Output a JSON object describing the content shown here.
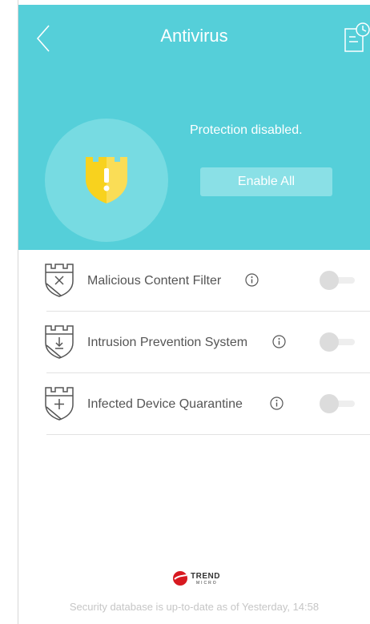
{
  "header": {
    "title": "Antivirus",
    "back_icon": "chevron-left-icon",
    "log_icon": "document-clock-icon",
    "background_color": "#55cfd9"
  },
  "status": {
    "shield_icon": "shield-warning-icon",
    "message": "Protection disabled.",
    "enable_all_label": "Enable All"
  },
  "features": [
    {
      "label": "Malicious Content Filter",
      "icon": "shield-x-icon",
      "enabled": false
    },
    {
      "label": "Intrusion Prevention System",
      "icon": "shield-download-icon",
      "enabled": false
    },
    {
      "label": "Infected Device Quarantine",
      "icon": "shield-plus-icon",
      "enabled": false
    }
  ],
  "footer": {
    "brand": "TREND",
    "brand_sub": "MICRO",
    "database_status": "Security database is up-to-date as of Yesterday, 14:58"
  },
  "colors": {
    "accent": "#55cfd9",
    "shield_yellow": "#f8d21e",
    "brand_red": "#d71920"
  }
}
